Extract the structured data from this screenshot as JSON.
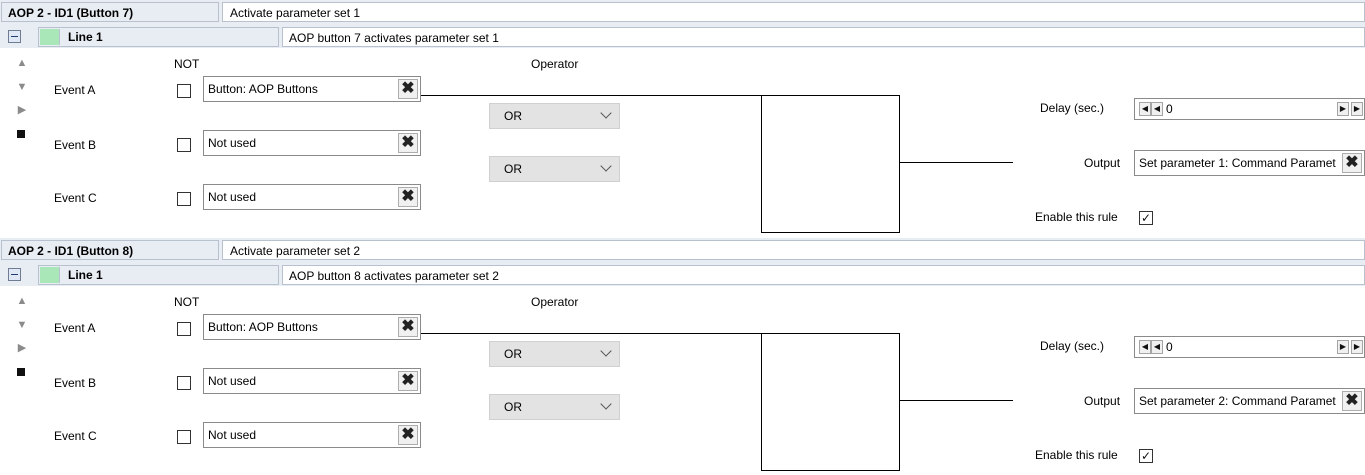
{
  "rules": [
    {
      "header_label": "AOP 2 - ID1 (Button 7)",
      "header_description": "Activate parameter set 1",
      "line_label": "Line 1",
      "line_description": "AOP button 7 activates parameter set 1",
      "not_label": "NOT",
      "operator_label": "Operator",
      "events": [
        {
          "label": "Event A",
          "value": "Button: AOP Buttons",
          "not_checked": false
        },
        {
          "label": "Event B",
          "value": "Not used",
          "not_checked": false
        },
        {
          "label": "Event C",
          "value": "Not used",
          "not_checked": false
        }
      ],
      "operators": [
        "OR",
        "OR"
      ],
      "delay_label": "Delay (sec.)",
      "delay_value": "0",
      "output_label": "Output",
      "output_value": "Set parameter 1: Command Paramet",
      "enable_label": "Enable this rule",
      "enabled": true
    },
    {
      "header_label": "AOP 2 - ID1 (Button 8)",
      "header_description": "Activate parameter set 2",
      "line_label": "Line 1",
      "line_description": "AOP button 8 activates parameter set 2",
      "not_label": "NOT",
      "operator_label": "Operator",
      "events": [
        {
          "label": "Event A",
          "value": "Button: AOP Buttons",
          "not_checked": false
        },
        {
          "label": "Event B",
          "value": "Not used",
          "not_checked": false
        },
        {
          "label": "Event C",
          "value": "Not used",
          "not_checked": false
        }
      ],
      "operators": [
        "OR",
        "OR"
      ],
      "delay_label": "Delay (sec.)",
      "delay_value": "0",
      "output_label": "Output",
      "output_value": "Set parameter 2: Command Paramet",
      "enable_label": "Enable this rule",
      "enabled": true
    }
  ],
  "icons": {
    "collapse": "minus-box-icon",
    "move_up": "triangle-up-icon",
    "move_down": "triangle-down-icon",
    "run": "triangle-right-icon",
    "stop": "square-stop-icon",
    "clear": "x-icon"
  },
  "colors": {
    "header_bg": "#e8edf4",
    "line_swatch": "#a9e7b9",
    "operator_bg": "#e3e3e3"
  }
}
